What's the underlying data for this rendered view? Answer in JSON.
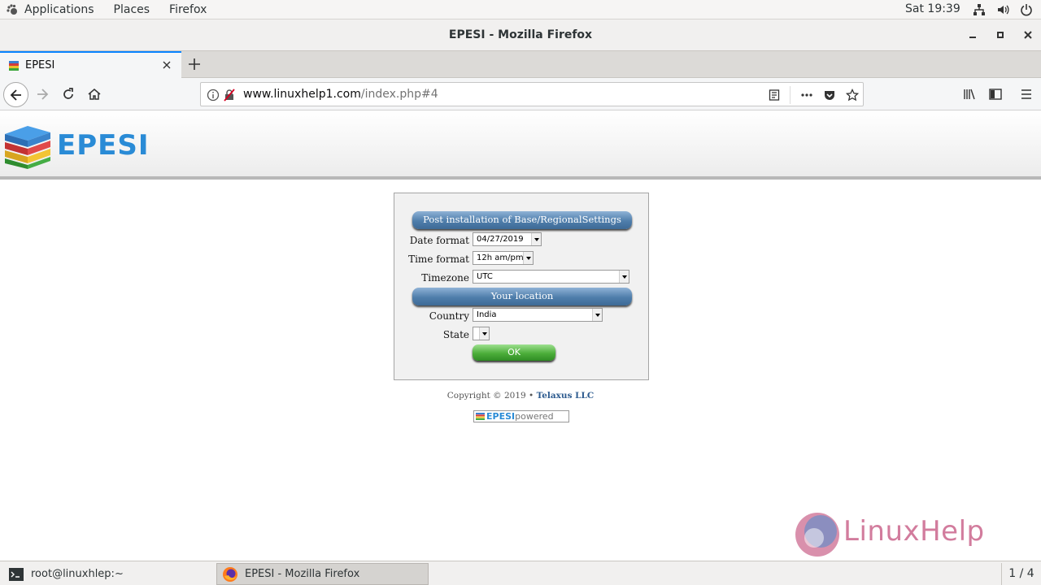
{
  "topbar": {
    "menus": [
      "Applications",
      "Places",
      "Firefox"
    ],
    "clock": "Sat 19:39",
    "tray_icons": [
      "network-icon",
      "volume-icon",
      "power-icon"
    ]
  },
  "window": {
    "title": "EPESI - Mozilla Firefox"
  },
  "tab": {
    "title": "EPESI"
  },
  "urlbar": {
    "host": "www.linuxhelp1.com",
    "path": "/index.php#4"
  },
  "page": {
    "logo_text": "EPESI",
    "section1": "Post installation of Base/RegionalSettings",
    "date_format_label": "Date format",
    "date_format_value": "04/27/2019",
    "time_format_label": "Time format",
    "time_format_value": "12h am/pm",
    "timezone_label": "Timezone",
    "timezone_value": "UTC",
    "section2": "Your location",
    "country_label": "Country",
    "country_value": "India",
    "state_label": "State",
    "state_value": "",
    "ok_label": "OK",
    "copyright_prefix": "Copyright © 2019 •",
    "copyright_company": "Telaxus LLC",
    "powered_epesi": "EPESI",
    "powered_word": "powered",
    "watermark": "LinuxHelp"
  },
  "taskbar": {
    "terminal": "root@linuxhlep:~",
    "firefox": "EPESI - Mozilla Firefox",
    "workspace": "1 / 4"
  }
}
